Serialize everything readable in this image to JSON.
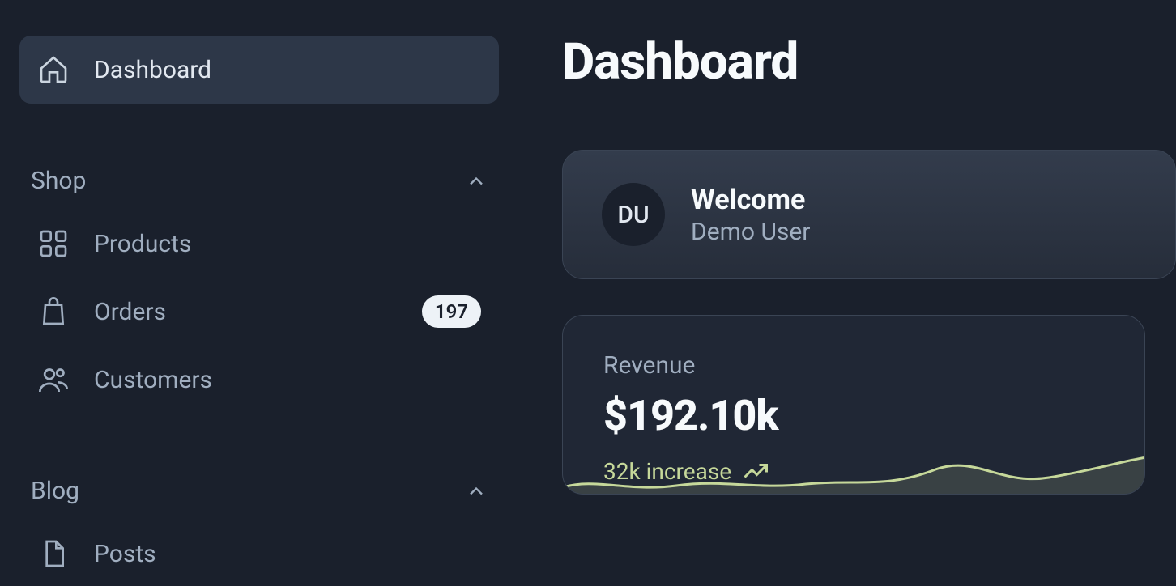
{
  "sidebar": {
    "dashboard": {
      "label": "Dashboard"
    },
    "shop": {
      "header": "Shop",
      "items": [
        {
          "label": "Products"
        },
        {
          "label": "Orders",
          "badge": "197"
        },
        {
          "label": "Customers"
        }
      ]
    },
    "blog": {
      "header": "Blog",
      "items": [
        {
          "label": "Posts"
        }
      ]
    }
  },
  "page": {
    "title": "Dashboard"
  },
  "welcome": {
    "avatar_initials": "DU",
    "headline": "Welcome",
    "username": "Demo User"
  },
  "stats": {
    "revenue": {
      "label": "Revenue",
      "value": "$192.10k",
      "change": "32k increase"
    }
  }
}
